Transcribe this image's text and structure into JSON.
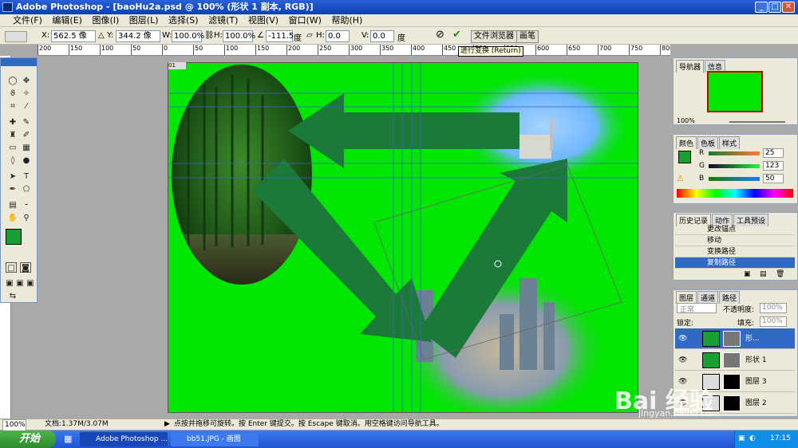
{
  "window": {
    "title": "Adobe Photoshop - [baoHu2a.psd @ 100% (形状 1 副本, RGB)]"
  },
  "menu": [
    "文件(F)",
    "编辑(E)",
    "图像(I)",
    "图层(L)",
    "选择(S)",
    "滤镜(T)",
    "视图(V)",
    "窗口(W)",
    "帮助(H)"
  ],
  "options": {
    "x_label": "X:",
    "x_value": "562.5 像",
    "y_label": "Y:",
    "y_value": "344.2 像",
    "w_label": "W:",
    "w_value": "100.0%",
    "h_label": "H:",
    "h_value": "100.0%",
    "angle_value": "-111.5",
    "angle_unit": "度",
    "hskew_label": "H:",
    "hskew_value": "0.0",
    "vskew_label": "V:",
    "vskew_value": "0.0",
    "hskew_unit": "度",
    "tab_files": "文件浏览器",
    "tab_brush": "画笔",
    "tooltip": "进行变换 (Return)"
  },
  "ruler_h": [
    "200",
    "150",
    "100",
    "50",
    "0",
    "50",
    "100",
    "150",
    "200",
    "250",
    "300",
    "350",
    "400",
    "450",
    "500",
    "550",
    "600",
    "650",
    "700",
    "750",
    "800",
    "850"
  ],
  "navigator": {
    "tab1": "导航器",
    "tab2": "信息",
    "zoom": "100%"
  },
  "color_panel": {
    "tab1": "颜色",
    "tab2": "色板",
    "tab3": "样式",
    "r_label": "R",
    "r_value": "25",
    "g_label": "G",
    "g_value": "123",
    "b_label": "B",
    "b_value": "50",
    "fg": "#19a032",
    "bg": "#00e600"
  },
  "history": {
    "tab1": "历史记录",
    "tab2": "动作",
    "tab3": "工具预设",
    "items": [
      "更改锚点",
      "移动",
      "变换路径",
      "复制路径"
    ]
  },
  "layers": {
    "tab1": "图层",
    "tab2": "通道",
    "tab3": "路径",
    "blend": "正常",
    "opacity_label": "不透明度:",
    "opacity_value": "100%",
    "lock_label": "锁定:",
    "fill_label": "填充:",
    "fill_value": "100%",
    "rows": [
      "形...",
      "形状 1",
      "图层 3",
      "图层 2"
    ]
  },
  "status": {
    "zoom": "100%",
    "doc": "文档:1.37M/3.07M",
    "hint": "点按并拖移可旋转。按 Enter 键提交。按 Escape 键取消。用空格键访问导航工具。"
  },
  "taskbar": {
    "start": "开始",
    "task1": "Adobe Photoshop ...",
    "task2": "bb51.JPG - 画图",
    "clock": "17:15"
  },
  "watermark": {
    "brand": "Bai 经验",
    "url": "jingyan.baidu.com"
  },
  "doc_tab": "01"
}
